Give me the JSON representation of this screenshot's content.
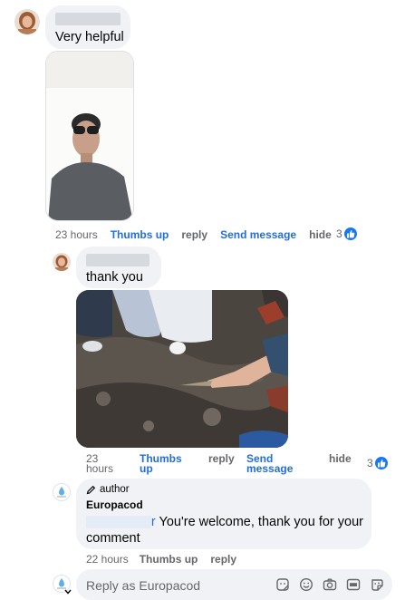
{
  "comment1": {
    "text": "Very helpful",
    "time": "23 hours",
    "actions": [
      "Thumbs up",
      "reply",
      "Send message",
      "hide"
    ],
    "reaction_count": "3"
  },
  "comment2": {
    "text": "thank you",
    "time_line1": "23",
    "time_line2": "hours",
    "thumbs_line1": "Thumbs",
    "thumbs_line2": "up",
    "reply": "reply",
    "send_line1": "Send",
    "send_line2": "message",
    "hide": "hide",
    "reaction_count": "3"
  },
  "author_reply": {
    "badge": "author",
    "name": "Europacod",
    "mention_tail": "r",
    "text_line1": " You're welcome, thank you for your",
    "text_line2": "comment",
    "time": "22 hours",
    "actions": [
      "Thumbs up",
      "reply"
    ]
  },
  "reply_box": {
    "placeholder": "Reply as Europacod",
    "icons": [
      "sticker-icon",
      "emoji-icon",
      "camera-icon",
      "gif-icon",
      "avatar-sticker-icon"
    ]
  },
  "colors": {
    "link_blue": "#216fdb",
    "like_blue": "#1877f2",
    "bubble_bg": "#f0f2f5",
    "muted_text": "#65676b"
  }
}
